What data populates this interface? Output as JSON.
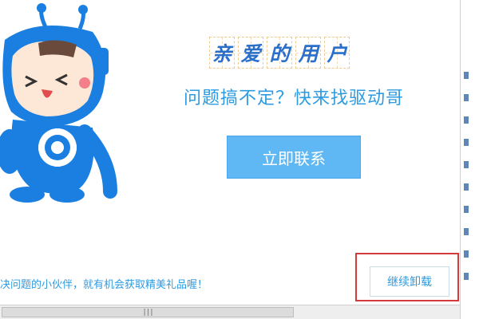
{
  "dialog": {
    "greeting_chars": [
      "亲",
      "爱",
      "的",
      "用",
      "户"
    ],
    "subtitle": "问题搞不定？快来找驱动哥",
    "contact_button": "立即联系",
    "promo_text": "决问题的小伙伴，就有机会获取精美礼品喔！",
    "continue_uninstall_button": "继续卸载",
    "mascot": "blue-robot-mascot"
  },
  "scrollbar": {
    "grip_label": "|||"
  },
  "colors": {
    "accent_blue": "#2e9be0",
    "button_blue": "#5fb8f4",
    "greeting_blue": "#2a6fc9",
    "highlight_red": "#d43a3a"
  }
}
